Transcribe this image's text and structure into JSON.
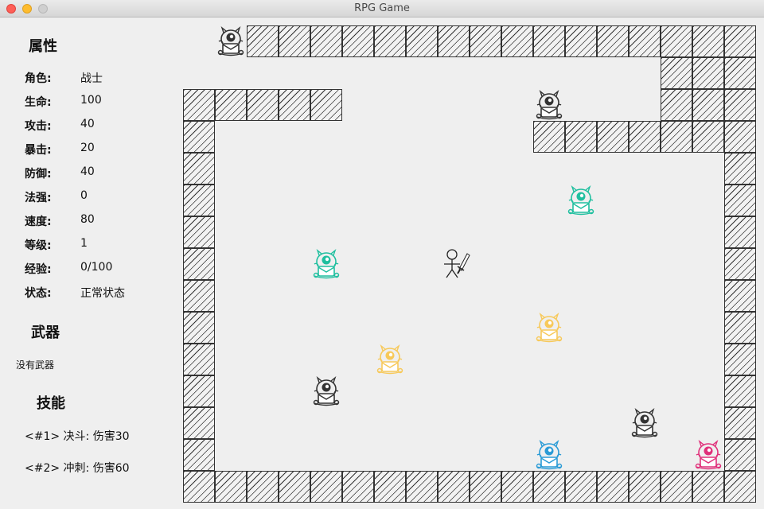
{
  "window": {
    "title": "RPG Game"
  },
  "attributes": {
    "title": "属性",
    "rows": [
      {
        "label": "角色:",
        "value": "战士"
      },
      {
        "label": "生命:",
        "value": "100"
      },
      {
        "label": "攻击:",
        "value": "40"
      },
      {
        "label": "暴击:",
        "value": "20"
      },
      {
        "label": "防御:",
        "value": "40"
      },
      {
        "label": "法强:",
        "value": "0"
      },
      {
        "label": "速度:",
        "value": "80"
      },
      {
        "label": "等级:",
        "value": "1"
      },
      {
        "label": "经验:",
        "value": "0/100"
      },
      {
        "label": "状态:",
        "value": "正常状态"
      }
    ]
  },
  "weapon": {
    "title": "武器",
    "value": "没有武器"
  },
  "skills": {
    "title": "技能",
    "items": [
      "<#1> 决斗: 伤害30",
      "<#2> 冲刺: 伤害60"
    ]
  },
  "colors": {
    "monster_black": "#333333",
    "monster_teal": "#1fbf9f",
    "monster_yellow": "#f7c95a",
    "monster_blue": "#2a9bd6",
    "monster_pink": "#e0307a",
    "wall_stroke": "#333333"
  },
  "map": {
    "cell": "grid",
    "monster_icon": "one-eyed-monster-icon",
    "hero_icon": "stick-figure-with-sword-icon"
  }
}
